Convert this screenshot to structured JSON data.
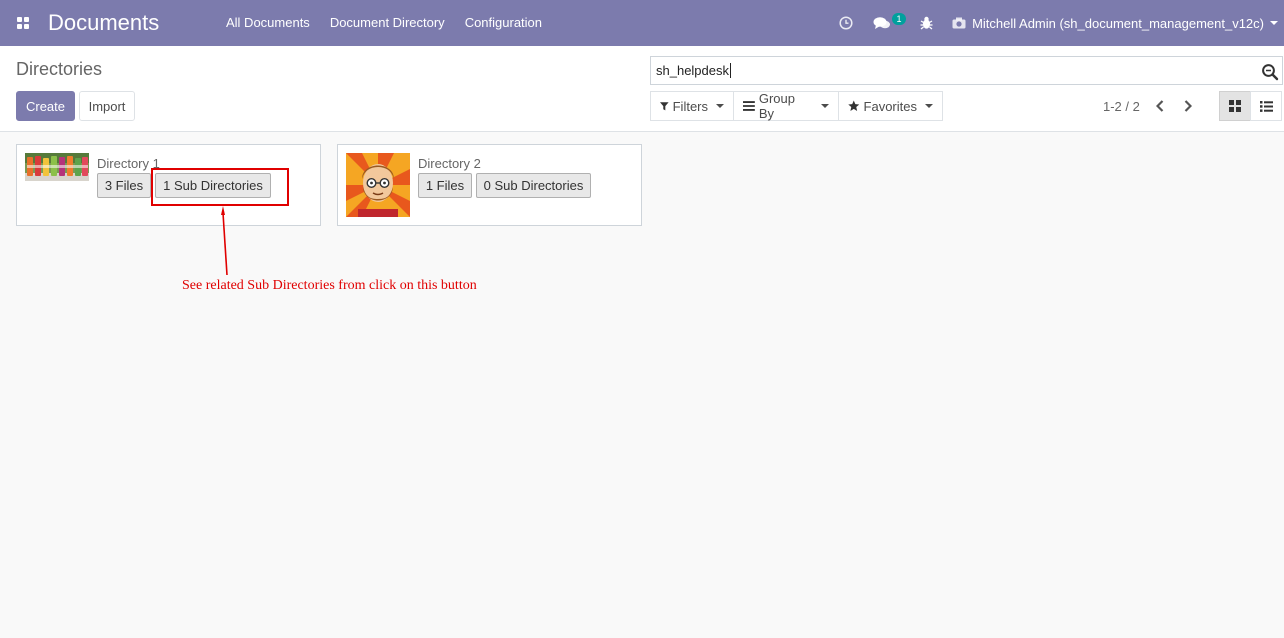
{
  "navbar": {
    "brand": "Documents",
    "menu": [
      "All Documents",
      "Document Directory",
      "Configuration"
    ],
    "messages_badge": "1",
    "user": "Mitchell Admin (sh_document_management_v12c)",
    "bg_color": "#7c7bad"
  },
  "control_panel": {
    "title": "Directories",
    "create_label": "Create",
    "import_label": "Import",
    "search_value": "sh_helpdesk",
    "filters_label": "Filters",
    "group_by_label": "Group By",
    "favorites_label": "Favorites",
    "pager_value": "1-2 / 2",
    "active_view": "kanban"
  },
  "directories": [
    {
      "name": "Directory 1",
      "files_label": "3 Files",
      "subdirs_label": "1 Sub Directories",
      "thumb": "bottles-image"
    },
    {
      "name": "Directory 2",
      "files_label": "1 Files",
      "subdirs_label": "0 Sub Directories",
      "thumb": "avatar-image"
    }
  ],
  "annotation": {
    "text": "See related Sub Directories from click on this button",
    "color": "#e00000"
  }
}
